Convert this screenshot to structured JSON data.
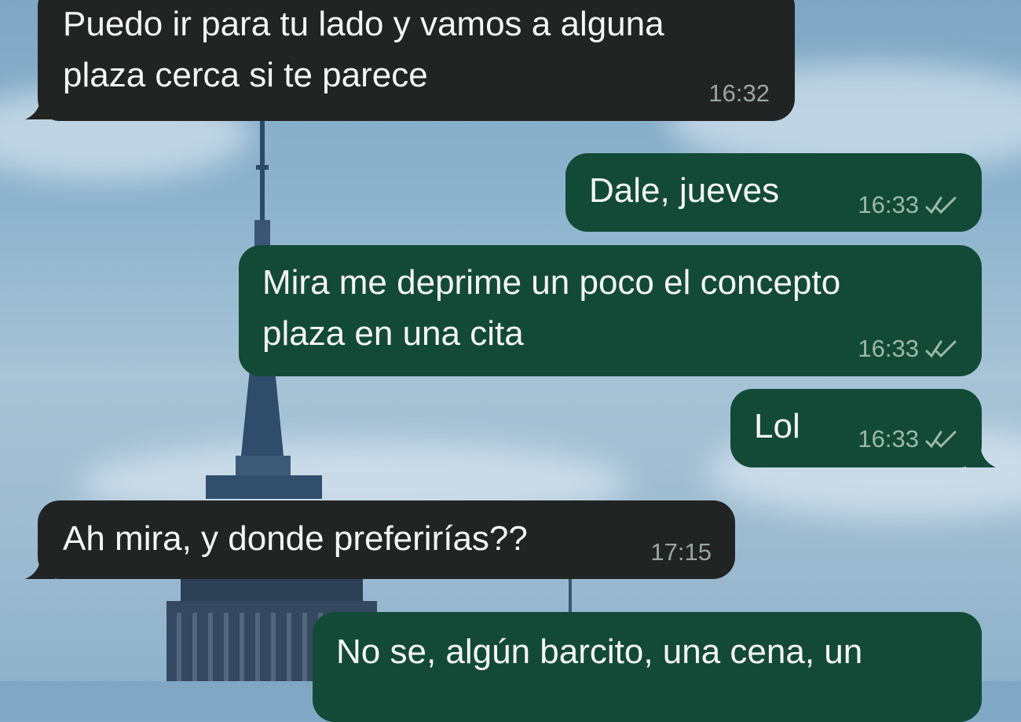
{
  "chat": {
    "messages": [
      {
        "direction": "incoming",
        "lines": [
          "Puedo ir para tu lado y vamos a alguna",
          "plaza cerca si te parece"
        ],
        "time": "16:32"
      },
      {
        "direction": "outgoing",
        "lines": [
          "Dale, jueves"
        ],
        "time": "16:33",
        "read": true
      },
      {
        "direction": "outgoing",
        "lines": [
          "Mira me deprime un poco el concepto",
          "plaza en una cita"
        ],
        "time": "16:33",
        "read": true
      },
      {
        "direction": "outgoing",
        "lines": [
          "Lol"
        ],
        "time": "16:33",
        "read": true
      },
      {
        "direction": "incoming",
        "lines": [
          "Ah mira, y donde preferirías??"
        ],
        "time": "17:15"
      },
      {
        "direction": "outgoing",
        "lines": [
          "No se, algún barcito, una cena, un"
        ],
        "time": null,
        "read": null
      }
    ]
  },
  "colors": {
    "incoming_bubble": "#222423",
    "outgoing_bubble": "#134a37",
    "text": "#f4f6f5",
    "sky": "#8db3cd"
  },
  "icons": {
    "read_receipt": "double-check-icon",
    "wallpaper": "empire-state-building-wallpaper"
  }
}
